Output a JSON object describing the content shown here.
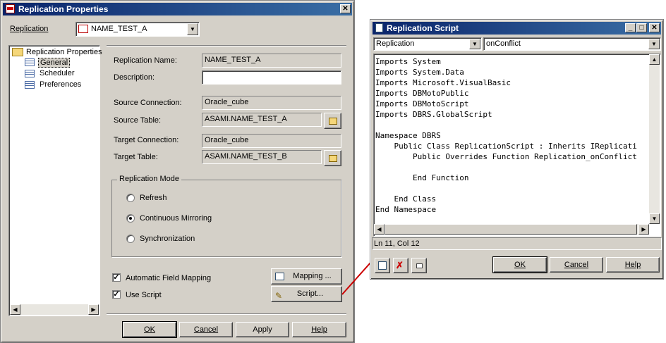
{
  "left_window": {
    "title": "Replication Properties",
    "close_glyph": "✕",
    "replication_label": "Replication",
    "replication_value": "NAME_TEST_A",
    "tree": {
      "root": "Replication Properties",
      "items": [
        "General",
        "Scheduler",
        "Preferences"
      ]
    },
    "fields": {
      "replication_name_label": "Replication Name:",
      "replication_name_value": "NAME_TEST_A",
      "description_label": "Description:",
      "description_value": "",
      "source_connection_label": "Source Connection:",
      "source_connection_value": "Oracle_cube",
      "source_table_label": "Source Table:",
      "source_table_value": "ASAMI.NAME_TEST_A",
      "target_connection_label": "Target Connection:",
      "target_connection_value": "Oracle_cube",
      "target_table_label": "Target Table:",
      "target_table_value": "ASAMI.NAME_TEST_B"
    },
    "mode_group": {
      "title": "Replication Mode",
      "options": [
        "Refresh",
        "Continuous Mirroring",
        "Synchronization"
      ],
      "selected": "Continuous Mirroring"
    },
    "checkboxes": {
      "auto_mapping": "Automatic Field Mapping",
      "use_script": "Use Script"
    },
    "buttons": {
      "mapping": "Mapping ...",
      "script": "Script...",
      "ok": "OK",
      "cancel": "Cancel",
      "apply": "Apply",
      "help": "Help"
    }
  },
  "right_window": {
    "title": "Replication Script",
    "object_combo": "Replication",
    "event_combo": "onConflict",
    "code_lines": [
      "Imports System",
      "Imports System.Data",
      "Imports Microsoft.VisualBasic",
      "Imports DBMotoPublic",
      "Imports DBMotoScript",
      "Imports DBRS.GlobalScript",
      "",
      "Namespace DBRS",
      "    Public Class ReplicationScript : Inherits IReplicati",
      "        Public Overrides Function Replication_onConflict",
      "",
      "        End Function",
      "",
      "    End Class",
      "End Namespace"
    ],
    "status": "Ln 11, Col 12",
    "buttons": {
      "ok": "OK",
      "cancel": "Cancel",
      "help": "Help"
    },
    "caption_buttons": {
      "minimize": "_",
      "maximize": "□",
      "close": "✕"
    }
  },
  "colors": {
    "title_active": "#0a246a",
    "face": "#d4d0c8",
    "connector": "#cc0000"
  }
}
